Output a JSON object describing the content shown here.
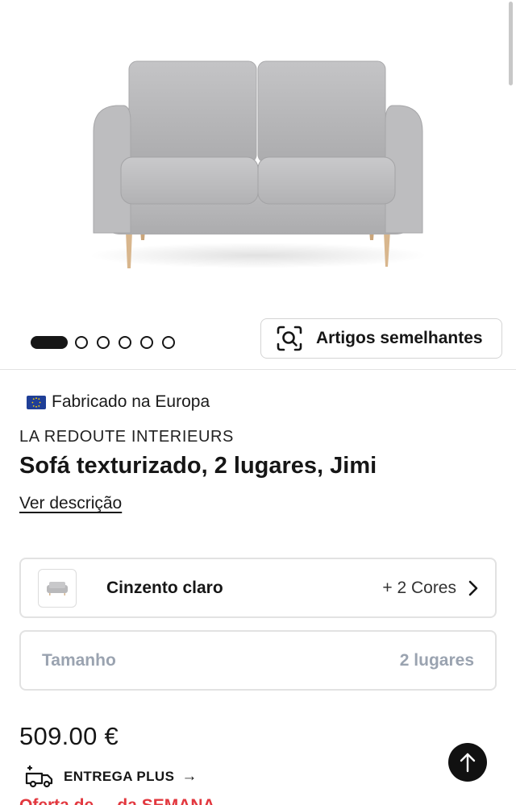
{
  "gallery": {
    "image_alt": "Sofá texturizado cinzento claro, 2 lugares",
    "image_count": 6,
    "active_index": 0,
    "similar_button_label": "Artigos semelhantes"
  },
  "product": {
    "origin_label": "Fabricado na Europa",
    "brand": "LA REDOUTE INTERIEURS",
    "title": "Sofá texturizado, 2 lugares, Jimi",
    "description_link": "Ver descrição"
  },
  "color_selector": {
    "selected_color": "Cinzento claro",
    "more_colors": "+ 2 Cores"
  },
  "size_selector": {
    "label": "Tamanho",
    "value": "2 lugares"
  },
  "price": "509.00 €",
  "delivery": {
    "label": "ENTREGA PLUS",
    "arrow": "→"
  },
  "offer_text": "Oferta de ... da SEMANA",
  "colors": {
    "text_primary": "#161616",
    "muted_gray": "#9aa3b0",
    "border": "#e2e2e2",
    "offer_red": "#e2383f",
    "sofa_gray": "#b9b9bb",
    "wood_legs": "#d6b58e"
  },
  "icons": [
    "visual-search-icon",
    "eu-flag-icon",
    "chevron-right-icon",
    "delivery-truck-icon",
    "arrow-up-icon"
  ]
}
